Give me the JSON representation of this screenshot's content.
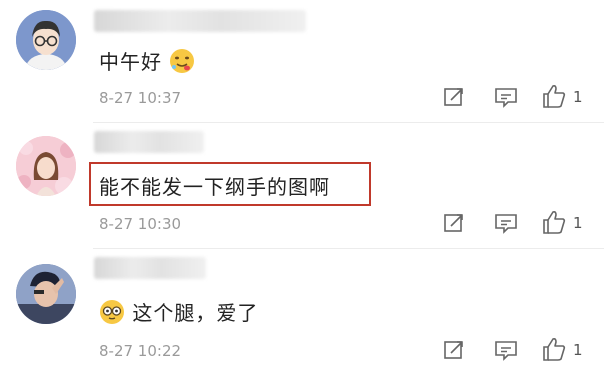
{
  "comments": [
    {
      "text": "中午好",
      "emoji": "drooling-face",
      "time": "8-27 10:37",
      "likes": "1"
    },
    {
      "text": "能不能发一下纲手的图啊",
      "time": "8-27 10:30",
      "likes": "1"
    },
    {
      "emoji": "glasses-face",
      "text": "这个腿，爱了",
      "time": "8-27 10:22",
      "likes": "1"
    }
  ]
}
